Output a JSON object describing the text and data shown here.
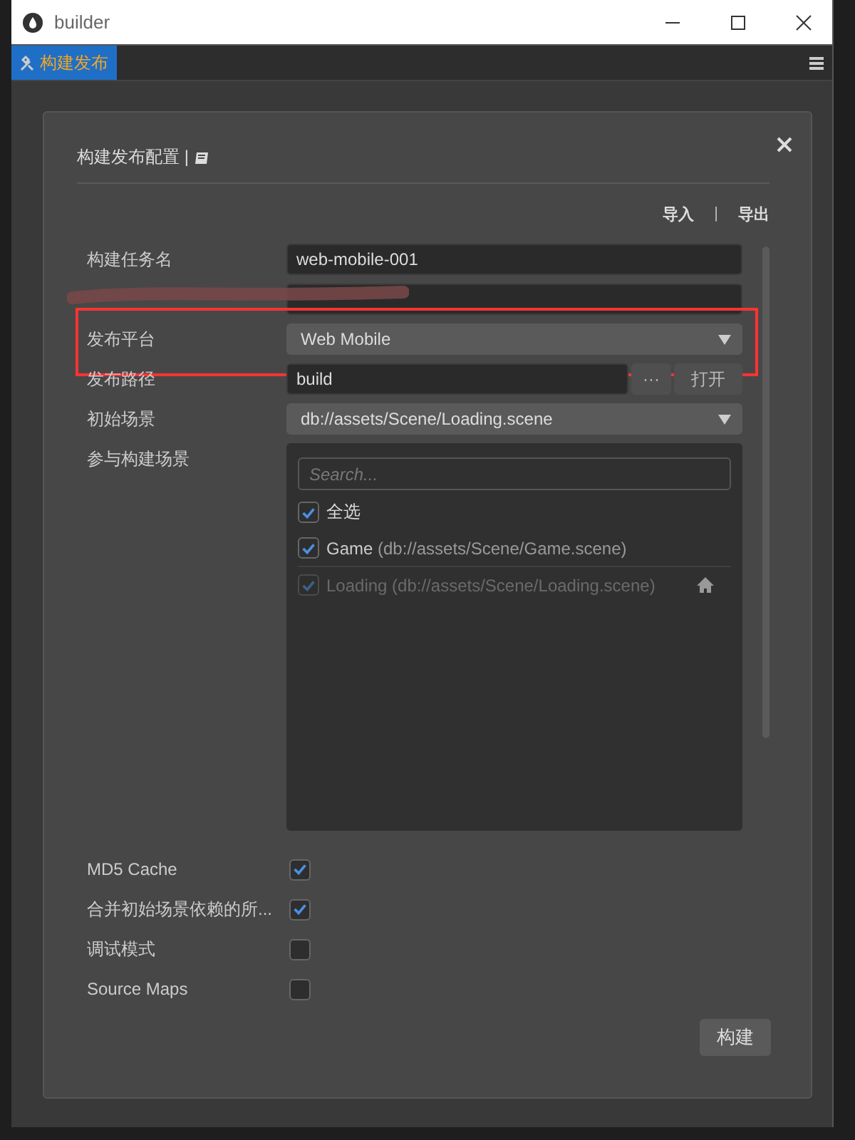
{
  "window": {
    "title": "builder"
  },
  "tabs": [
    {
      "label": "构建发布",
      "selected": true
    }
  ],
  "dialog": {
    "title": "构建发布配置 |",
    "actions": [
      "导入",
      "|",
      "导出"
    ],
    "fields": [
      {
        "kind": "text",
        "label": "构建任务名",
        "value": "web-mobile-001"
      },
      {
        "kind": "text"
      },
      {
        "kind": "select",
        "label": "发布平台",
        "value": "Web Mobile",
        "highlighted": true
      },
      {
        "kind": "path",
        "label": "发布路径",
        "value": "build",
        "buttons": [
          "···",
          "打开"
        ]
      },
      {
        "kind": "select",
        "label": "初始场景",
        "value": "db://assets/Scene/Loading.scene"
      },
      {
        "kind": "scenes",
        "label": "参与构建场景",
        "placeholder": "Search...",
        "select_all": {
          "label": "全选",
          "checked": true
        },
        "scenes": [
          {
            "name": "Game",
            "path": "(db://assets/Scene/Game.scene)",
            "checked": true,
            "disabled": false,
            "start": false
          },
          {
            "name": "Loading",
            "path": "(db://assets/Scene/Loading.scene)",
            "checked": true,
            "disabled": true,
            "start": true
          }
        ]
      }
    ],
    "options": [
      {
        "label": "MD5 Cache",
        "checked": true
      },
      {
        "label": "合并初始场景依赖的所...",
        "checked": true
      },
      {
        "label": "调试模式",
        "checked": false
      },
      {
        "label": "Source Maps",
        "checked": false
      }
    ],
    "build_button": "构建"
  }
}
